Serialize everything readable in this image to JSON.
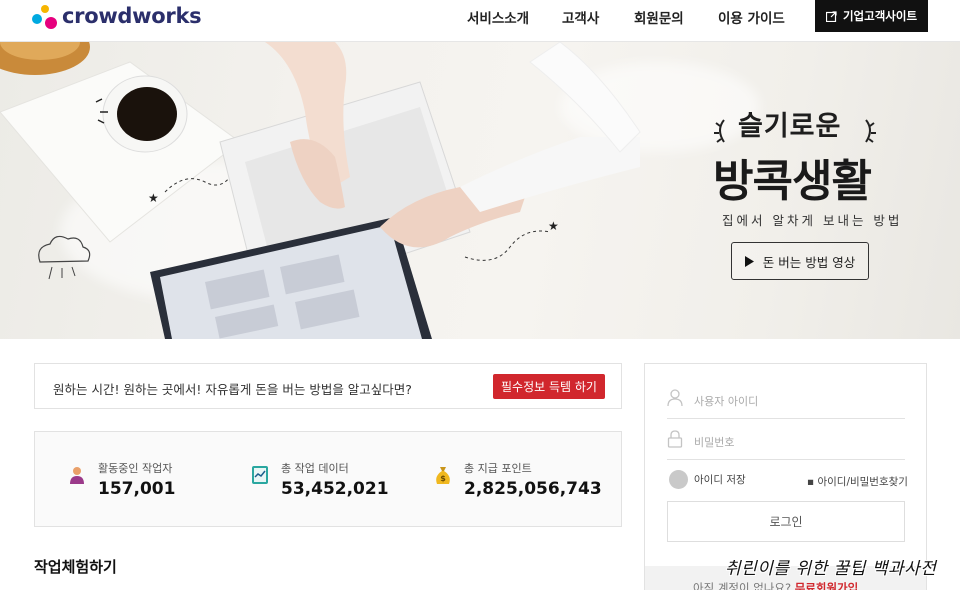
{
  "header": {
    "logo_text": "crowdworks",
    "nav": [
      "서비스소개",
      "고객사",
      "회원문의",
      "이용 가이드"
    ],
    "corp_button": "기업고객사이트"
  },
  "hero": {
    "title_sub": "슬기로운",
    "title_main": "방콕생활",
    "desc": "집에서 알차게 보내는 방법",
    "video_button": "돈 버는 방법 영상"
  },
  "banner": {
    "text": "원하는 시간! 원하는 곳에서! 자유롭게 돈을 버는 방법을 알고싶다면?",
    "button": "필수정보 득템 하기"
  },
  "stats": [
    {
      "label": "활동중인 작업자",
      "value": "157,001",
      "icon": "worker-icon"
    },
    {
      "label": "총 작업 데이터",
      "value": "53,452,021",
      "icon": "data-icon"
    },
    {
      "label": "총 지급 포인트",
      "value": "2,825,056,743",
      "icon": "money-bag-icon"
    }
  ],
  "section_title": "작업체험하기",
  "login": {
    "username_placeholder": "사용자 아이디",
    "password_placeholder": "비밀번호",
    "remember_label": "아이디 저장",
    "find_link": "아이디/비밀번호찾기",
    "login_button": "로그인",
    "signup_prompt": "아직 계정이 없나요?",
    "signup_link": "무료회원가입"
  },
  "watermark": "취린이를 위한 꿀팁 백과사전",
  "colors": {
    "brand_navy": "#2b2f6b",
    "accent_red": "#d1272d",
    "corp_button_bg": "#111111"
  }
}
